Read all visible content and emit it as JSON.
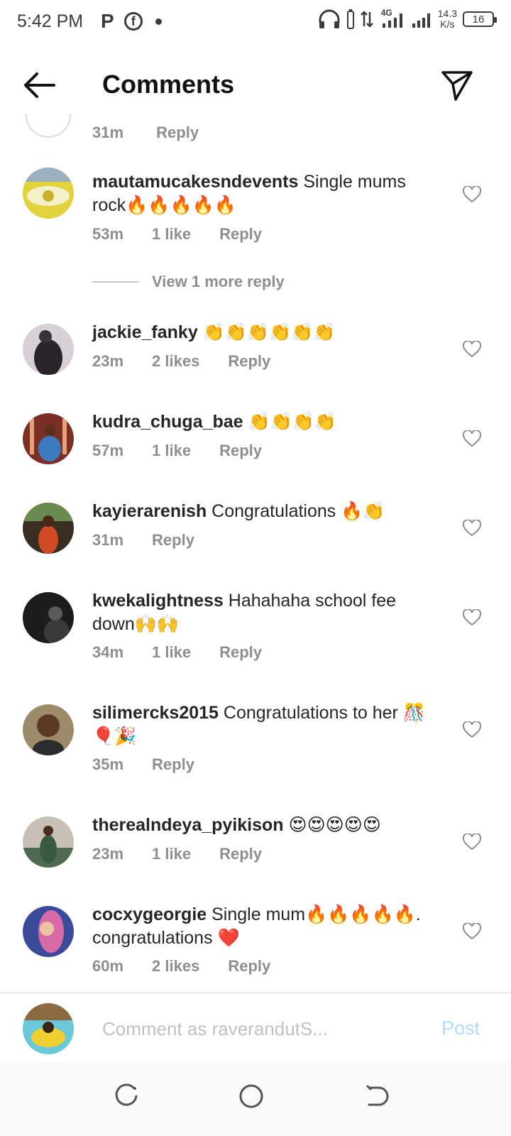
{
  "status_bar": {
    "time": "5:42 PM",
    "p_icon": "P",
    "fb_icon": "f",
    "network": "4G",
    "speed_top": "14.3",
    "speed_bottom": "K/s",
    "battery": "16"
  },
  "header": {
    "title": "Comments"
  },
  "partial_comment": {
    "time": "31m",
    "reply": "Reply"
  },
  "comments": [
    {
      "user": "mautamucakesndevents",
      "text": " Single mums rock🔥🔥🔥🔥🔥",
      "time": "53m",
      "likes": "1 like",
      "reply": "Reply",
      "avatar_color": "#d8c84a"
    },
    {
      "user": "jackie_fanky",
      "text": " 👏👏👏👏👏👏",
      "time": "23m",
      "likes": "2 likes",
      "reply": "Reply",
      "avatar_color": "#3a3236"
    },
    {
      "user": "kudra_chuga_bae",
      "text": " 👏👏👏👏",
      "time": "57m",
      "likes": "1 like",
      "reply": "Reply",
      "avatar_color": "#8a3a2c"
    },
    {
      "user": "kayierarenish",
      "text": " Congratulations 🔥👏",
      "time": "31m",
      "likes": "",
      "reply": "Reply",
      "avatar_color": "#4b3a28"
    },
    {
      "user": "kwekalightness",
      "text": " Hahahaha school fee down🙌🙌",
      "time": "34m",
      "likes": "1 like",
      "reply": "Reply",
      "avatar_color": "#2a2a2a"
    },
    {
      "user": "silimercks2015",
      "text": " Congratulations  to her 🎊🎈🎉",
      "time": "35m",
      "likes": "",
      "reply": "Reply",
      "avatar_color": "#7a6a48"
    },
    {
      "user": "therealndeya_pyikison",
      "text": " 😍😍😍😍😍",
      "time": "23m",
      "likes": "1 like",
      "reply": "Reply",
      "avatar_color": "#4e6b52"
    },
    {
      "user": "cocxygeorgie",
      "text": " Single mum🔥🔥🔥🔥🔥. congratulations ❤️",
      "time": "60m",
      "likes": "2 likes",
      "reply": "Reply",
      "avatar_color": "#6a5cc8"
    }
  ],
  "view_more": "View 1 more reply",
  "compose": {
    "placeholder": "Comment as raverandutS...",
    "post_label": "Post"
  },
  "colors": {
    "meta_gray": "#8e8e8e",
    "post_disabled": "#b3dbff",
    "text": "#262626"
  },
  "icons": [
    "back-arrow-icon",
    "send-icon",
    "heart-icon",
    "recents-icon",
    "home-icon",
    "back-nav-icon"
  ]
}
